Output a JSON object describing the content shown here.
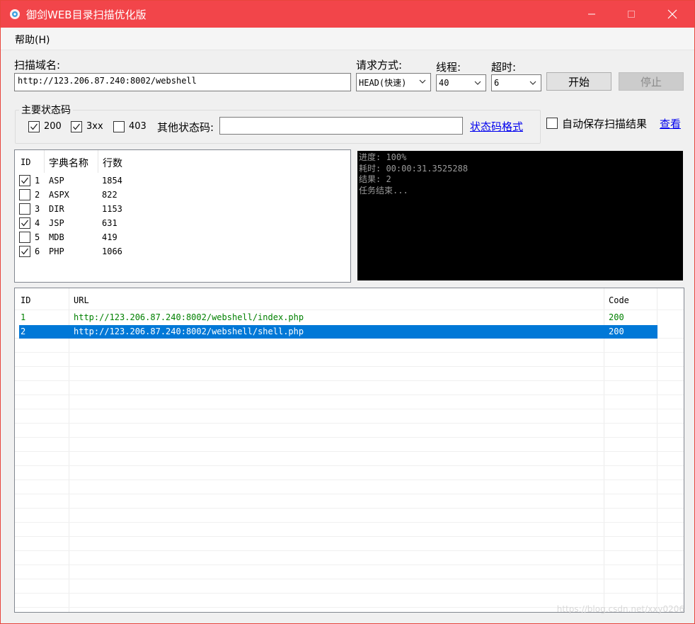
{
  "window": {
    "title": "御剑WEB目录扫描优化版",
    "menu": "帮助(H)",
    "title_bar_color": "#f2454a"
  },
  "scan": {
    "domain_label": "扫描域名:",
    "domain_value": "http://123.206.87.240:8002/webshell",
    "method_label": "请求方式:",
    "method_value": "HEAD(快速)",
    "threads_label": "线程:",
    "threads_value": "40",
    "timeout_label": "超时:",
    "timeout_value": "6",
    "start_label": "开始",
    "stop_label": "停止"
  },
  "status_codes": {
    "group_title": "主要状态码",
    "code_200": "200",
    "code_3xx": "3xx",
    "code_403": "403",
    "other_label": "其他状态码:",
    "other_value": "",
    "format_link": "状态码格式",
    "autosave_label": "自动保存扫描结果",
    "view_link": "查看"
  },
  "dictionaries": {
    "headers": [
      "ID",
      "字典名称",
      "行数"
    ],
    "rows": [
      {
        "id": "1",
        "name": "ASP",
        "lines": "1854",
        "checked": true
      },
      {
        "id": "2",
        "name": "ASPX",
        "lines": "822",
        "checked": false
      },
      {
        "id": "3",
        "name": "DIR",
        "lines": "1153",
        "checked": false
      },
      {
        "id": "4",
        "name": "JSP",
        "lines": "631",
        "checked": true
      },
      {
        "id": "5",
        "name": "MDB",
        "lines": "419",
        "checked": false
      },
      {
        "id": "6",
        "name": "PHP",
        "lines": "1066",
        "checked": true
      }
    ]
  },
  "console": {
    "lines": [
      "进度: 100%",
      "耗时: 00:00:31.3525288",
      "结果: 2",
      "任务结束..."
    ]
  },
  "results": {
    "headers": [
      "ID",
      "URL",
      "Code"
    ],
    "rows": [
      {
        "id": "1",
        "url": "http://123.206.87.240:8002/webshell/index.php",
        "code": "200"
      },
      {
        "id": "2",
        "url": "http://123.206.87.240:8002/webshell/shell.php",
        "code": "200"
      }
    ]
  },
  "watermark": "https://blog.csdn.net/xxy0206",
  "colors": {
    "selection": "#0078d7",
    "result_text": "#008000",
    "link": "#0000ee"
  }
}
